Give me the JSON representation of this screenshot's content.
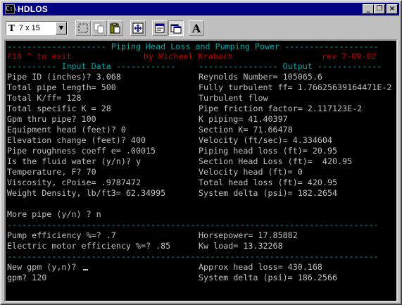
{
  "window": {
    "title": "HDLOS",
    "controls": [
      "_",
      "❒",
      "×"
    ]
  },
  "toolbar": {
    "font_icon": "T",
    "font_size": "7 x 15",
    "tools": [
      "mark-icon",
      "copy-icon",
      "paste-icon",
      "fullscreen-icon",
      "properties-icon",
      "background-icon",
      "font-icon"
    ],
    "font_button_label": "A"
  },
  "console": {
    "header_rule": "-------------------- Piping Head Loss and Pumping Power -------------------",
    "exit_hint": "F10 ^ to exit",
    "author": "by Michael Krabach",
    "revision": "rev 7-09-02",
    "input_header": "---------- Input Data ------------",
    "output_header": "---------------- Output -------------",
    "left_lines": [
      "Pipe ID (inches)? 3.068",
      "Total pipe length= 500",
      "Total K/ff= 128",
      "Total specific K = 28",
      "Gpm thru pipe? 100",
      "Equipment head (feet)? 0",
      "Elevation change (feet)? 400",
      "Pipe roughness coeff e= .00015",
      "Is the fluid water (y/n)? y",
      "Temperature, F? 70",
      "Viscosity, cPoise= .9787472",
      "Weight Density, lb/ft3= 62.34995"
    ],
    "right_lines": [
      "Reynolds Number= 105065.6",
      "Fully turbulent ff= 1.76625639164471E-2",
      "Turbulent flow",
      "Pipe friction factor= 2.117123E-2",
      "K piping= 41.40397",
      "Section K= 71.66478",
      "Velocity (ft/sec)= 4.334604",
      "Piping head loss (ft)= 20.95",
      "Section Head Loss (ft)=  420.95",
      "Velocity head (ft)= 0",
      "Total head loss (ft)= 420.95",
      "System delta (psi)= 182.2654"
    ],
    "more_pipe": "More pipe (y/n) ? n",
    "divider": "---------------------------------------------------------------------------",
    "pump_efficiency": "Pump efficiency %=? .7",
    "horsepower": "Horsepower= 17.85882",
    "motor_efficiency": "Electric motor efficiency %=? .85",
    "kw_load": "Kw load= 13.32268",
    "new_gpm": "New gpm (y,n)? ",
    "approx_head": "Approx head loss= 430.168",
    "gpm": "gpm? 120",
    "system_delta2": "System delta (psi)= 186.2566"
  },
  "colors": {
    "console_bg": "#000000",
    "console_text": "#c0c0c0",
    "header": "#00a8a8",
    "exit_line": "#c00000",
    "titlebar": "#000080"
  }
}
